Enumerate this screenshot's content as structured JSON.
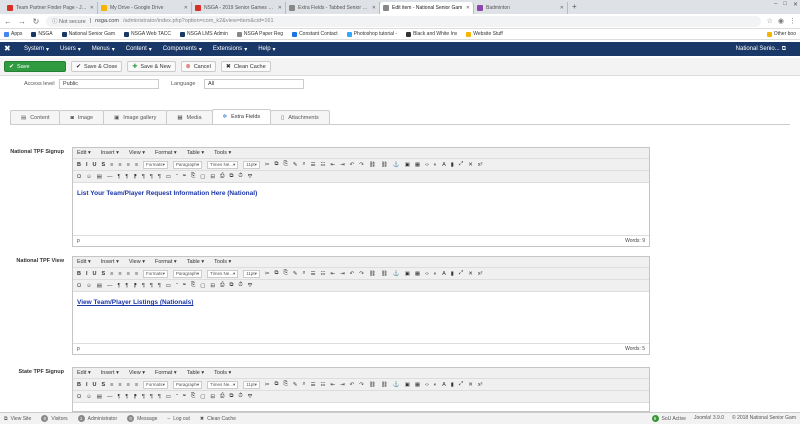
{
  "browser": {
    "tabs": [
      {
        "title": "Team Partner Finder Page - Join",
        "color": "#d93025",
        "active": false
      },
      {
        "title": "My Drive - Google Drive",
        "color": "#f4b400",
        "active": false
      },
      {
        "title": "NSGA - 2019 Senior Games - Co",
        "color": "#d93025",
        "active": false
      },
      {
        "title": "Extra Fields - Tabbed Senior Ga",
        "color": "#888888",
        "active": false
      },
      {
        "title": "Edit item - National Senior Gam",
        "color": "#888888",
        "active": true
      },
      {
        "title": "Badminton",
        "color": "#8e44ad",
        "active": false
      }
    ],
    "security": "Not secure",
    "url_host": "nsga.com",
    "url_path": "/administrator/index.php?option=com_k2&view=item&cid=161",
    "bookmarks": [
      {
        "label": "Apps",
        "color": "#4285f4"
      },
      {
        "label": "NSGA",
        "color": "#1a3867"
      },
      {
        "label": "National Senior Gam",
        "color": "#1a3867"
      },
      {
        "label": "NSGA Web TACC",
        "color": "#1a3867"
      },
      {
        "label": "NSGA LMS Admin",
        "color": "#1a3867"
      },
      {
        "label": "NSGA Paper Reg",
        "color": "#888888"
      },
      {
        "label": "Constant Contact",
        "color": "#1a73e8"
      },
      {
        "label": "Photoshop tutorial -",
        "color": "#31a8ff"
      },
      {
        "label": "Black and White Inv",
        "color": "#333333"
      },
      {
        "label": "Website Stuff",
        "color": "#f4b400"
      }
    ],
    "other_bookmarks": "Other boo"
  },
  "adminmenu": {
    "items": [
      "System",
      "Users",
      "Menus",
      "Content",
      "Components",
      "Extensions",
      "Help"
    ],
    "right": "National Senio..."
  },
  "toolbar": {
    "save": "Save",
    "save_close": "Save & Close",
    "save_new": "Save & New",
    "cancel": "Cancel",
    "clean_cache": "Clean Cache"
  },
  "access": {
    "access_label": "Access level",
    "access_value": "Public",
    "language_label": "Language",
    "language_value": "All"
  },
  "content_tabs": [
    {
      "label": "Content",
      "icon": "document-icon",
      "active": false
    },
    {
      "label": "Image",
      "icon": "camera-icon",
      "active": false
    },
    {
      "label": "Image gallery",
      "icon": "images-icon",
      "active": false
    },
    {
      "label": "Media",
      "icon": "film-icon",
      "active": false
    },
    {
      "label": "Extra Fields",
      "icon": "gear-icon",
      "active": true
    },
    {
      "label": "Attachments",
      "icon": "paperclip-icon",
      "active": false
    }
  ],
  "editor_menu": [
    "Edit",
    "Insert",
    "View",
    "Format",
    "Table",
    "Tools"
  ],
  "editor_dropdowns": [
    "Formats",
    "Paragraph",
    "Times Ne...",
    "11pt"
  ],
  "fields": [
    {
      "label": "National TPF Signup",
      "content": "List Your Team/Player Request Information Here (National)",
      "underline": false,
      "path": "p",
      "words": "Words: 9"
    },
    {
      "label": "National TPF View",
      "content": "View Team/Player Listings (Nationals)",
      "underline": true,
      "path": "p",
      "words": "Words: 5"
    },
    {
      "label": "State TPF Signup",
      "content": "",
      "underline": false,
      "path": "",
      "words": ""
    }
  ],
  "statusbar": {
    "view_site": "View Site",
    "visitors_count": "0",
    "visitors": "Visitors",
    "admin_count": "1",
    "administrator": "Administrator",
    "message_count": "0",
    "messages": "Message",
    "logout": "Log out",
    "clean_cache": "Clean Cache",
    "sql_count": "9",
    "sql_label": "SoU Active",
    "version": "Joomla! 3.9.0",
    "copyright": "© 2018 National Senior Gam"
  }
}
